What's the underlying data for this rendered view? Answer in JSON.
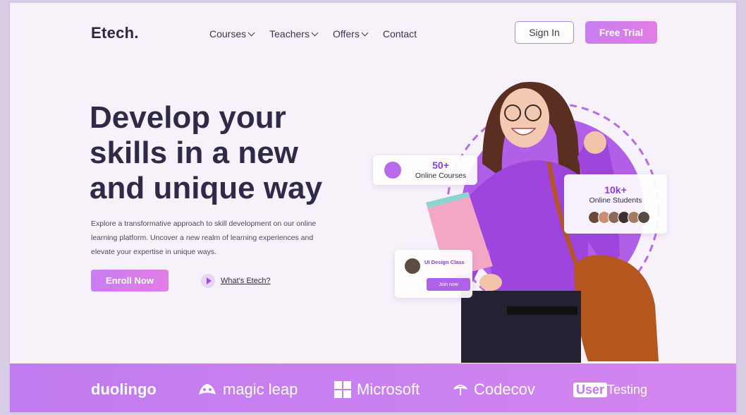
{
  "nav": {
    "logo": "Etech.",
    "menu": [
      {
        "label": "Courses",
        "dropdown": true
      },
      {
        "label": "Teachers",
        "dropdown": true
      },
      {
        "label": "Offers",
        "dropdown": true
      },
      {
        "label": "Contact",
        "dropdown": false
      }
    ],
    "sign_in": "Sign In",
    "free_trial": "Free Trial"
  },
  "hero": {
    "headline_line1": "Develop your",
    "headline_line2": "skills in a new",
    "headline_line3": "and unique way",
    "subtext_line1": "Explore a transformative approach to skill development on our online",
    "subtext_line2": "learning platform. Uncover a new realm of learning experiences and",
    "subtext_line3": "elevate your expertise in unique ways.",
    "enroll_label": "Enroll Now",
    "whats_label": "What's Etech?"
  },
  "stats": {
    "courses_num": "50+",
    "courses_label": "Online Courses",
    "students_num": "10k+",
    "students_label": "Online Students"
  },
  "class_card": {
    "title": "UI Design Class",
    "join_label": "Join now"
  },
  "brands": {
    "duolingo": "duolingo",
    "magicleap": "magic leap",
    "microsoft": "Microsoft",
    "codecov": "Codecov",
    "usertesting_box": "User",
    "usertesting_rest": "Testing"
  },
  "colors": {
    "accent": "#b061ea",
    "brand_bar": "#c07bf0",
    "text_dark": "#2f2a48"
  }
}
